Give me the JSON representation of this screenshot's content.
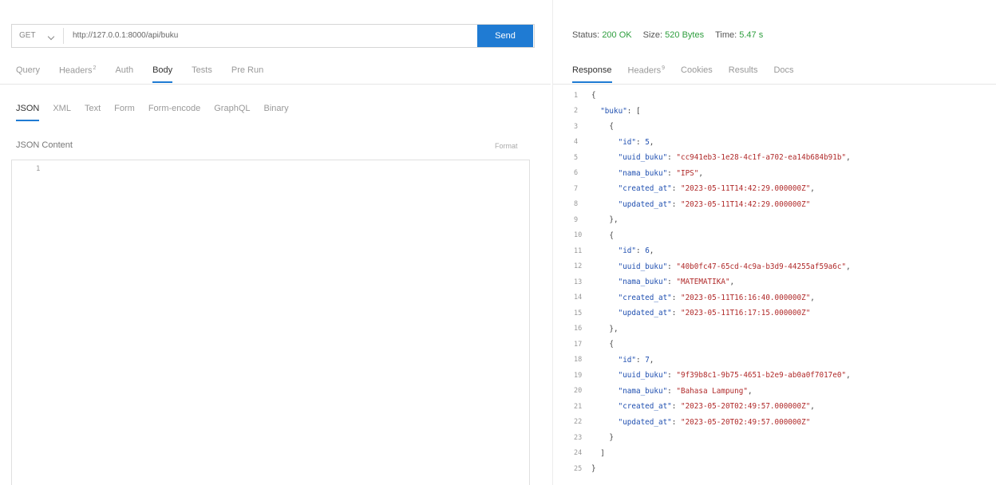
{
  "request": {
    "method": "GET",
    "url": "http://127.0.0.1:8000/api/buku",
    "send_label": "Send",
    "tabs": [
      {
        "label": "Query",
        "badge": ""
      },
      {
        "label": "Headers",
        "badge": "2"
      },
      {
        "label": "Auth",
        "badge": ""
      },
      {
        "label": "Body",
        "badge": ""
      },
      {
        "label": "Tests",
        "badge": ""
      },
      {
        "label": "Pre Run",
        "badge": ""
      }
    ],
    "active_tab": "Body",
    "body_tabs": [
      "JSON",
      "XML",
      "Text",
      "Form",
      "Form-encode",
      "GraphQL",
      "Binary"
    ],
    "active_body_tab": "JSON",
    "content_label": "JSON Content",
    "format_label": "Format",
    "editor_line": "1"
  },
  "response": {
    "status_label": "Status:",
    "status_value": "200 OK",
    "size_label": "Size:",
    "size_value": "520 Bytes",
    "time_label": "Time:",
    "time_value": "5.47 s",
    "tabs": [
      {
        "label": "Response",
        "badge": ""
      },
      {
        "label": "Headers",
        "badge": "9"
      },
      {
        "label": "Cookies",
        "badge": ""
      },
      {
        "label": "Results",
        "badge": ""
      },
      {
        "label": "Docs",
        "badge": ""
      }
    ],
    "active_tab": "Response",
    "lines": [
      {
        "n": "1",
        "indent": "",
        "parts": [
          {
            "t": "{",
            "c": "txt"
          }
        ]
      },
      {
        "n": "2",
        "indent": "  ",
        "parts": [
          {
            "t": "\"buku\"",
            "c": "k"
          },
          {
            "t": ": [",
            "c": "txt"
          }
        ]
      },
      {
        "n": "3",
        "indent": "    ",
        "parts": [
          {
            "t": "{",
            "c": "txt"
          }
        ]
      },
      {
        "n": "4",
        "indent": "      ",
        "parts": [
          {
            "t": "\"id\"",
            "c": "k"
          },
          {
            "t": ": ",
            "c": "txt"
          },
          {
            "t": "5",
            "c": "n"
          },
          {
            "t": ",",
            "c": "txt"
          }
        ]
      },
      {
        "n": "5",
        "indent": "      ",
        "parts": [
          {
            "t": "\"uuid_buku\"",
            "c": "k"
          },
          {
            "t": ": ",
            "c": "txt"
          },
          {
            "t": "\"cc941eb3-1e28-4c1f-a702-ea14b684b91b\"",
            "c": "s"
          },
          {
            "t": ",",
            "c": "txt"
          }
        ]
      },
      {
        "n": "6",
        "indent": "      ",
        "parts": [
          {
            "t": "\"nama_buku\"",
            "c": "k"
          },
          {
            "t": ": ",
            "c": "txt"
          },
          {
            "t": "\"IPS\"",
            "c": "s"
          },
          {
            "t": ",",
            "c": "txt"
          }
        ]
      },
      {
        "n": "7",
        "indent": "      ",
        "parts": [
          {
            "t": "\"created_at\"",
            "c": "k"
          },
          {
            "t": ": ",
            "c": "txt"
          },
          {
            "t": "\"2023-05-11T14:42:29.000000Z\"",
            "c": "s"
          },
          {
            "t": ",",
            "c": "txt"
          }
        ]
      },
      {
        "n": "8",
        "indent": "      ",
        "parts": [
          {
            "t": "\"updated_at\"",
            "c": "k"
          },
          {
            "t": ": ",
            "c": "txt"
          },
          {
            "t": "\"2023-05-11T14:42:29.000000Z\"",
            "c": "s"
          }
        ]
      },
      {
        "n": "9",
        "indent": "    ",
        "parts": [
          {
            "t": "},",
            "c": "txt"
          }
        ]
      },
      {
        "n": "10",
        "indent": "    ",
        "parts": [
          {
            "t": "{",
            "c": "txt"
          }
        ]
      },
      {
        "n": "11",
        "indent": "      ",
        "parts": [
          {
            "t": "\"id\"",
            "c": "k"
          },
          {
            "t": ": ",
            "c": "txt"
          },
          {
            "t": "6",
            "c": "n"
          },
          {
            "t": ",",
            "c": "txt"
          }
        ]
      },
      {
        "n": "12",
        "indent": "      ",
        "parts": [
          {
            "t": "\"uuid_buku\"",
            "c": "k"
          },
          {
            "t": ": ",
            "c": "txt"
          },
          {
            "t": "\"40b0fc47-65cd-4c9a-b3d9-44255af59a6c\"",
            "c": "s"
          },
          {
            "t": ",",
            "c": "txt"
          }
        ]
      },
      {
        "n": "13",
        "indent": "      ",
        "parts": [
          {
            "t": "\"nama_buku\"",
            "c": "k"
          },
          {
            "t": ": ",
            "c": "txt"
          },
          {
            "t": "\"MATEMATIKA\"",
            "c": "s"
          },
          {
            "t": ",",
            "c": "txt"
          }
        ]
      },
      {
        "n": "14",
        "indent": "      ",
        "parts": [
          {
            "t": "\"created_at\"",
            "c": "k"
          },
          {
            "t": ": ",
            "c": "txt"
          },
          {
            "t": "\"2023-05-11T16:16:40.000000Z\"",
            "c": "s"
          },
          {
            "t": ",",
            "c": "txt"
          }
        ]
      },
      {
        "n": "15",
        "indent": "      ",
        "parts": [
          {
            "t": "\"updated_at\"",
            "c": "k"
          },
          {
            "t": ": ",
            "c": "txt"
          },
          {
            "t": "\"2023-05-11T16:17:15.000000Z\"",
            "c": "s"
          }
        ]
      },
      {
        "n": "16",
        "indent": "    ",
        "parts": [
          {
            "t": "},",
            "c": "txt"
          }
        ]
      },
      {
        "n": "17",
        "indent": "    ",
        "parts": [
          {
            "t": "{",
            "c": "txt"
          }
        ]
      },
      {
        "n": "18",
        "indent": "      ",
        "parts": [
          {
            "t": "\"id\"",
            "c": "k"
          },
          {
            "t": ": ",
            "c": "txt"
          },
          {
            "t": "7",
            "c": "n"
          },
          {
            "t": ",",
            "c": "txt"
          }
        ]
      },
      {
        "n": "19",
        "indent": "      ",
        "parts": [
          {
            "t": "\"uuid_buku\"",
            "c": "k"
          },
          {
            "t": ": ",
            "c": "txt"
          },
          {
            "t": "\"9f39b8c1-9b75-4651-b2e9-ab0a0f7017e0\"",
            "c": "s"
          },
          {
            "t": ",",
            "c": "txt"
          }
        ]
      },
      {
        "n": "20",
        "indent": "      ",
        "parts": [
          {
            "t": "\"nama_buku\"",
            "c": "k"
          },
          {
            "t": ": ",
            "c": "txt"
          },
          {
            "t": "\"Bahasa Lampung\"",
            "c": "s"
          },
          {
            "t": ",",
            "c": "txt"
          }
        ]
      },
      {
        "n": "21",
        "indent": "      ",
        "parts": [
          {
            "t": "\"created_at\"",
            "c": "k"
          },
          {
            "t": ": ",
            "c": "txt"
          },
          {
            "t": "\"2023-05-20T02:49:57.000000Z\"",
            "c": "s"
          },
          {
            "t": ",",
            "c": "txt"
          }
        ]
      },
      {
        "n": "22",
        "indent": "      ",
        "parts": [
          {
            "t": "\"updated_at\"",
            "c": "k"
          },
          {
            "t": ": ",
            "c": "txt"
          },
          {
            "t": "\"2023-05-20T02:49:57.000000Z\"",
            "c": "s"
          }
        ]
      },
      {
        "n": "23",
        "indent": "    ",
        "parts": [
          {
            "t": "}",
            "c": "txt"
          }
        ]
      },
      {
        "n": "24",
        "indent": "  ",
        "parts": [
          {
            "t": "]",
            "c": "txt"
          }
        ]
      },
      {
        "n": "25",
        "indent": "",
        "parts": [
          {
            "t": "}",
            "c": "txt"
          }
        ]
      }
    ]
  },
  "colors": {
    "accent": "#1f7bd3",
    "status_ok": "#2e9e3e",
    "json_key": "#1f4fb0",
    "json_string": "#b02a2a"
  }
}
